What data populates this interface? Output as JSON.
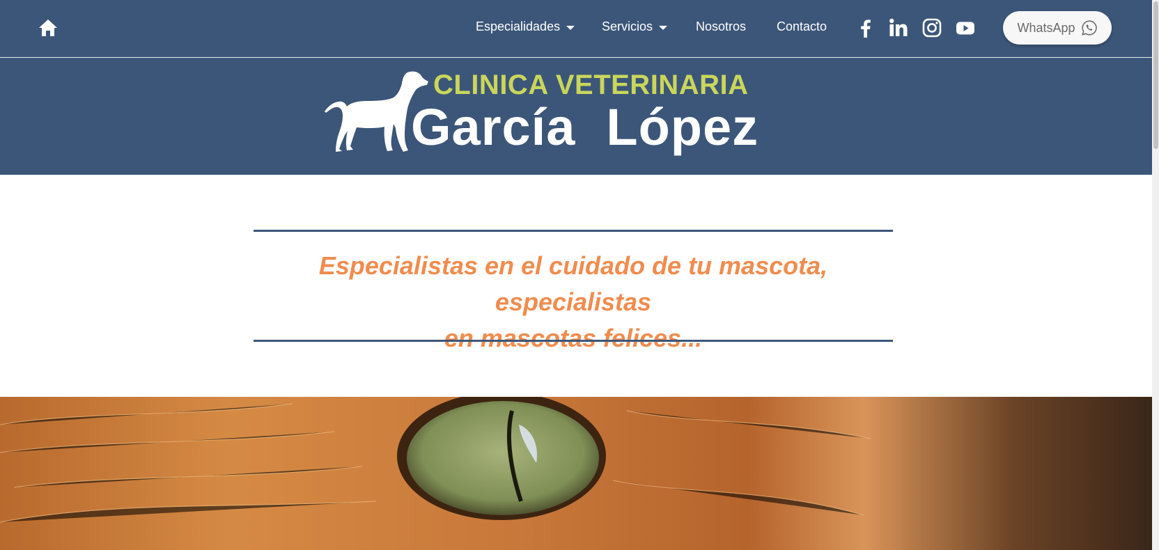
{
  "nav": {
    "items": [
      {
        "label": "Especialidades",
        "has_dropdown": true
      },
      {
        "label": "Servicios",
        "has_dropdown": true
      },
      {
        "label": "Nosotros",
        "has_dropdown": false
      },
      {
        "label": "Contacto",
        "has_dropdown": false
      }
    ],
    "social": [
      "facebook-icon",
      "linkedin-icon",
      "instagram-icon",
      "youtube-icon"
    ],
    "whatsapp_label": "WhatsApp"
  },
  "logo": {
    "title": "CLINICA VETERINARIA",
    "name_first": "García",
    "name_last": "López"
  },
  "tagline": {
    "line1": "Especialistas en el cuidado de tu mascota, especialistas",
    "line2": "en mascotas felices..."
  },
  "hero": {
    "image": "cat-eye-photo"
  },
  "colors": {
    "primary": "#3c5679",
    "accent": "#f08c4e",
    "logo_title": "#c9d65a"
  }
}
